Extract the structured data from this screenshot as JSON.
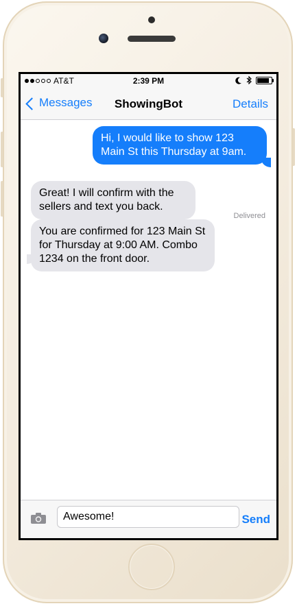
{
  "status_bar": {
    "carrier": "AT&T",
    "time": "2:39 PM",
    "signal_bars_full": 2,
    "signal_bars_total": 5,
    "battery_level": 0.85,
    "icons": [
      "moon-icon",
      "bluetooth-icon",
      "battery-icon"
    ]
  },
  "nav": {
    "back_label": "Messages",
    "title": "ShowingBot",
    "details_label": "Details"
  },
  "messages": [
    {
      "direction": "outgoing",
      "text": "Hi, I would like to show 123 Main St this Thursday at 9am."
    },
    {
      "direction": "incoming",
      "text": "Great! I will confirm with the sellers and text you back."
    },
    {
      "direction": "incoming",
      "text": "You are confirmed for 123 Main St for Thursday at 9:00 AM. Combo 1234 on the front door."
    }
  ],
  "delivered_label": "Delivered",
  "composer": {
    "value": "Awesome!",
    "send_label": "Send",
    "camera_icon": "camera-icon"
  },
  "colors": {
    "accent": "#157efb",
    "incoming_bubble": "#e5e5ea",
    "phone_frame": "#f4ecdf"
  }
}
